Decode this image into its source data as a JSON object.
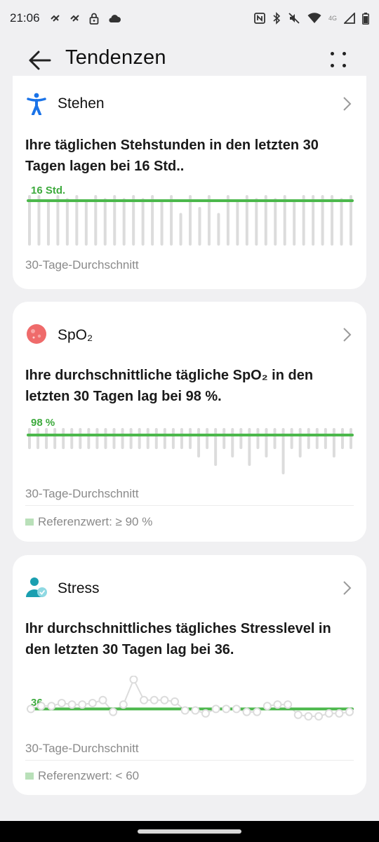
{
  "status_bar": {
    "time": "21:06",
    "network_label": "4G",
    "icons": [
      "notification-icon",
      "notification-icon",
      "lock-icon",
      "cloud-icon",
      "nfc-icon",
      "bluetooth-icon",
      "mute-icon",
      "wifi-icon",
      "signal-icon",
      "battery-icon"
    ]
  },
  "app_bar": {
    "title": "Tendenzen",
    "back_icon": "arrow-left-icon",
    "more_icon": "more-dots-icon"
  },
  "cards": {
    "stand": {
      "title": "Stehen",
      "icon": "standing-person-icon",
      "description": "Ihre täglichen Stehstunden in den letzten 30 Tagen lagen bei 16 Std..",
      "avg_label": "16 Std.",
      "caption": "30-Tage-Durchschnitt",
      "accent": "#4cb84c"
    },
    "spo2": {
      "title": "SpO₂",
      "icon": "blood-oxygen-icon",
      "description": "Ihre durchschnittliche tägliche SpO₂ in den letzten 30 Tagen lag bei 98 %.",
      "avg_label": "98 %",
      "caption": "30-Tage-Durchschnitt",
      "reference": "Referenzwert: ≥ 90 %",
      "accent": "#4cb84c"
    },
    "stress": {
      "title": "Stress",
      "icon": "stress-person-icon",
      "description": "Ihr durchschnittliches tägliches Stresslevel in den letzten 30 Tagen lag bei 36.",
      "avg_label": "36",
      "caption": "30-Tage-Durchschnitt",
      "reference": "Referenzwert: < 60",
      "accent": "#4cb84c"
    }
  },
  "chart_data": [
    {
      "type": "bar",
      "title": "Stehen",
      "average": 16,
      "unit": "Std.",
      "values": [
        16,
        16,
        14,
        16,
        15,
        16,
        14,
        16,
        15,
        16,
        15,
        16,
        15,
        16,
        14,
        16,
        10,
        16,
        12,
        16,
        10,
        16,
        14,
        16,
        15,
        16,
        15,
        16,
        14,
        16,
        16,
        16,
        16,
        15,
        16
      ],
      "ylim": [
        0,
        16
      ]
    },
    {
      "type": "bar",
      "title": "SpO₂",
      "average": 98,
      "unit": "%",
      "values": [
        98,
        98,
        98,
        98,
        98,
        98,
        98,
        98,
        98,
        98,
        98,
        98,
        98,
        98,
        98,
        98,
        98,
        98,
        98,
        98,
        97,
        98,
        96,
        98,
        97,
        98,
        96,
        98,
        97,
        98,
        95,
        98,
        97,
        98,
        98,
        98,
        97,
        98,
        98
      ],
      "reference": "≥ 90 %"
    },
    {
      "type": "line",
      "title": "Stress",
      "average": 36,
      "values": [
        36,
        38,
        38,
        40,
        39,
        39,
        40,
        42,
        34,
        39,
        56,
        42,
        42,
        42,
        41,
        35,
        35,
        33,
        36,
        36,
        36,
        34,
        34,
        38,
        39,
        39,
        32,
        31,
        31,
        33,
        33,
        34
      ],
      "reference": "< 60"
    }
  ]
}
